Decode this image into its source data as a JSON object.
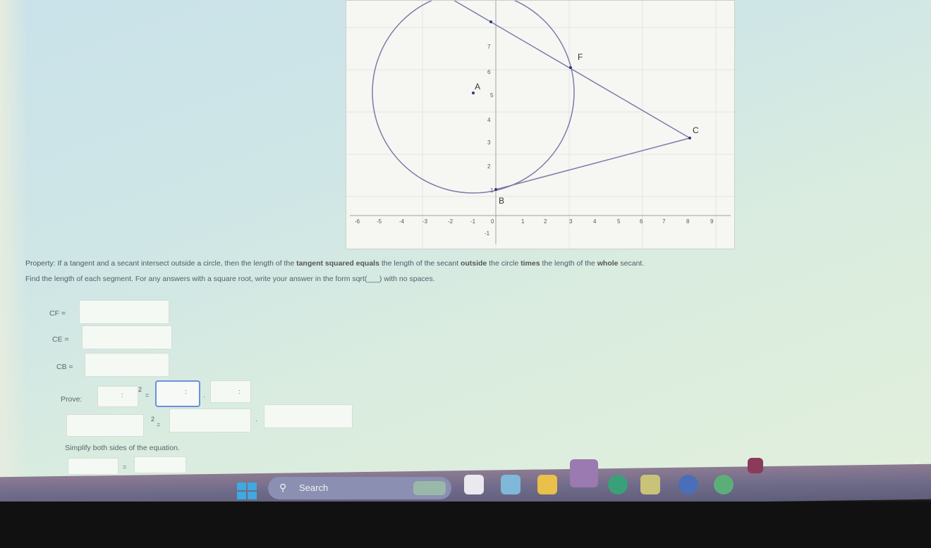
{
  "graph": {
    "points": {
      "A": "A",
      "B": "B",
      "C": "C",
      "F": "F"
    },
    "x_ticks": [
      "-6",
      "-5",
      "-4",
      "-3",
      "-2",
      "-1",
      "0",
      "1",
      "2",
      "3",
      "4",
      "5",
      "6",
      "7",
      "8",
      "9"
    ],
    "y_ticks": [
      "7",
      "6",
      "5",
      "4",
      "3",
      "2",
      "1",
      "-1"
    ]
  },
  "text": {
    "property_start": "Property: If a tangent and a secant intersect outside a circle, then the length of the ",
    "property_bold1": "tangent squared equals",
    "property_mid": " the length of the secant ",
    "property_bold2": "outside",
    "property_mid2": " the circle ",
    "property_bold3": "times",
    "property_mid3": " the length of the ",
    "property_bold4": "whole",
    "property_end": " secant.",
    "instructions": "Find the length of each segment. For any answers with a square root, write your answer in the form sqrt(___) with no spaces.",
    "cf_label": "CF =",
    "ce_label": "CE =",
    "cb_label": "CB =",
    "prove_label": "Prove:",
    "colon1": ":",
    "sup2": "2",
    "eq": "=",
    "colon2": ":",
    "dot": "·",
    "colon3": ":",
    "sup2b": "2",
    "eq2": "=",
    "dot2": "·",
    "simplify": "Simplify both sides of the equation.",
    "eq3": "="
  },
  "taskbar": {
    "search_label": "Search"
  },
  "colors": {
    "circle": "#7e7aa8",
    "accent_box": "#6b8fe0"
  }
}
